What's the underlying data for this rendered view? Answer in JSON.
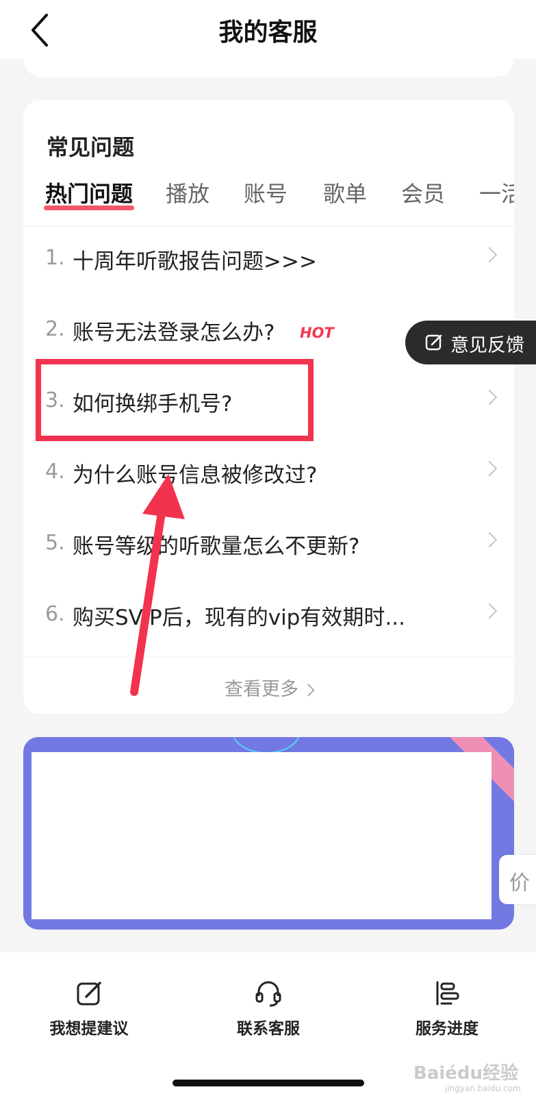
{
  "header": {
    "title": "我的客服"
  },
  "faq": {
    "title": "常见问题",
    "tabs": [
      "热门问题",
      "播放",
      "账号",
      "歌单",
      "会员",
      "一活"
    ],
    "questions": [
      {
        "num": "1.",
        "text": "十周年听歌报告问题>>>"
      },
      {
        "num": "2.",
        "text": "账号无法登录怎么办?",
        "badge": "HOT"
      },
      {
        "num": "3.",
        "text": "如何换绑手机号?"
      },
      {
        "num": "4.",
        "text": "为什么账号信息被修改过?"
      },
      {
        "num": "5.",
        "text": "账号等级的听歌量怎么不更新?"
      },
      {
        "num": "6.",
        "text": "购买SVIP后，现有的vip有效期时..."
      }
    ],
    "more_label": "查看更多"
  },
  "feedback_float": {
    "label": "意见反馈",
    "icon": "edit-icon"
  },
  "price_tab": {
    "label": "价"
  },
  "bottom_actions": [
    {
      "label": "我想提建议",
      "icon": "edit-icon"
    },
    {
      "label": "联系客服",
      "icon": "headset-icon"
    },
    {
      "label": "服务进度",
      "icon": "progress-list-icon"
    }
  ],
  "watermark": {
    "brand": "Baiédu经验",
    "url": "jingyan.baidu.com"
  },
  "colors": {
    "accent": "#f0394f",
    "banner": "#7379e2",
    "highlight": "#f2334d"
  }
}
